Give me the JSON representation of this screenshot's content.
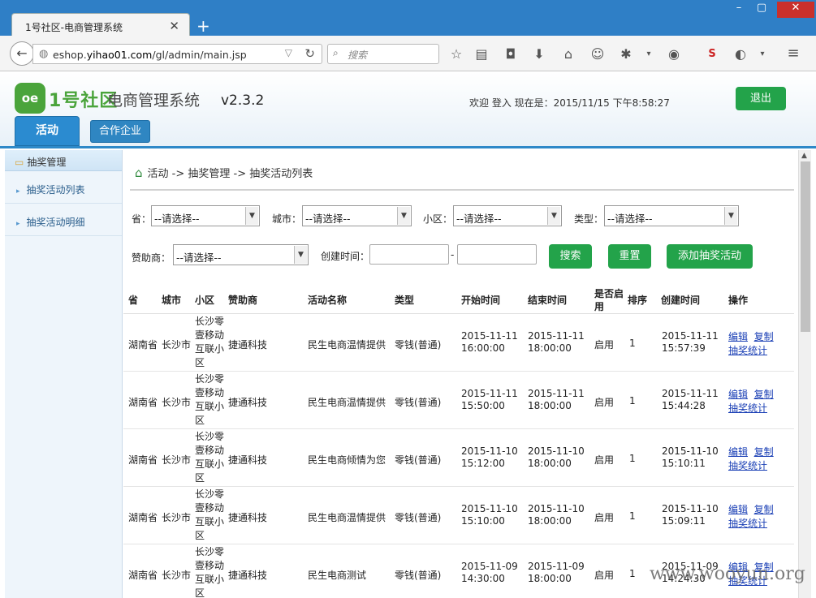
{
  "browser": {
    "tab_title": "1号社区-电商管理系统",
    "url_prefix": "eshop.",
    "url_domain": "yihao01.com",
    "url_path": "/gl/admin/main.jsp",
    "search_placeholder": "搜索"
  },
  "header": {
    "logo_text": "oe",
    "brand": "1号社区",
    "system_name": "电商管理系统",
    "version": "v2.3.2",
    "welcome": "欢迎   登入 现在是：2015/11/15 下午8:58:27",
    "logout_label": "退出",
    "tabs": [
      {
        "label": "活动"
      },
      {
        "label": "合作企业"
      }
    ]
  },
  "sidebar": {
    "title": "抽奖管理",
    "items": [
      {
        "label": "抽奖活动列表"
      },
      {
        "label": "抽奖活动明细"
      }
    ]
  },
  "breadcrumb": "活动 -> 抽奖管理 -> 抽奖活动列表",
  "filters": {
    "province_label": "省：",
    "city_label": "城市：",
    "community_label": "小区：",
    "type_label": "类型：",
    "sponsor_label": "赞助商：",
    "created_label": "创建时间：",
    "range_sep": "-",
    "select_default": "--请选择--",
    "search_btn": "搜索",
    "reset_btn": "重置",
    "add_btn": "添加抽奖活动"
  },
  "table": {
    "headers": [
      "省",
      "城市",
      "小区",
      "赞助商",
      "活动名称",
      "类型",
      "开始时间",
      "结束时间",
      "是否启用",
      "排序",
      "创建时间",
      "操作"
    ],
    "edit": "编辑",
    "copy": "复制",
    "stats": "抽奖统计",
    "rows": [
      {
        "province": "湖南省",
        "city": "长沙市",
        "community": "长沙零壹移动互联小区",
        "sponsor": "捷通科技",
        "name": "民生电商温情提供",
        "type": "零钱(普通)",
        "start_date": "2015-11-11",
        "start_time": "16:00:00",
        "end_date": "2015-11-11",
        "end_time": "18:00:00",
        "enabled": "启用",
        "order": "1",
        "created_date": "2015-11-11",
        "created_time": "15:57:39"
      },
      {
        "province": "湖南省",
        "city": "长沙市",
        "community": "长沙零壹移动互联小区",
        "sponsor": "捷通科技",
        "name": "民生电商温情提供",
        "type": "零钱(普通)",
        "start_date": "2015-11-11",
        "start_time": "15:50:00",
        "end_date": "2015-11-11",
        "end_time": "18:00:00",
        "enabled": "启用",
        "order": "1",
        "created_date": "2015-11-11",
        "created_time": "15:44:28"
      },
      {
        "province": "湖南省",
        "city": "长沙市",
        "community": "长沙零壹移动互联小区",
        "sponsor": "捷通科技",
        "name": "民生电商倾情为您",
        "type": "零钱(普通)",
        "start_date": "2015-11-10",
        "start_time": "15:12:00",
        "end_date": "2015-11-10",
        "end_time": "18:00:00",
        "enabled": "启用",
        "order": "1",
        "created_date": "2015-11-10",
        "created_time": "15:10:11"
      },
      {
        "province": "湖南省",
        "city": "长沙市",
        "community": "长沙零壹移动互联小区",
        "sponsor": "捷通科技",
        "name": "民生电商温情提供",
        "type": "零钱(普通)",
        "start_date": "2015-11-10",
        "start_time": "15:10:00",
        "end_date": "2015-11-10",
        "end_time": "18:00:00",
        "enabled": "启用",
        "order": "1",
        "created_date": "2015-11-10",
        "created_time": "15:09:11"
      },
      {
        "province": "湖南省",
        "city": "长沙市",
        "community": "长沙零壹移动互联小区",
        "sponsor": "捷通科技",
        "name": "民生电商测试",
        "type": "零钱(普通)",
        "start_date": "2015-11-09",
        "start_time": "14:30:00",
        "end_date": "2015-11-09",
        "end_time": "18:00:00",
        "enabled": "启用",
        "order": "1",
        "created_date": "2015-11-09",
        "created_time": "14:24:30"
      }
    ]
  },
  "watermark": "www.wooyun.org"
}
